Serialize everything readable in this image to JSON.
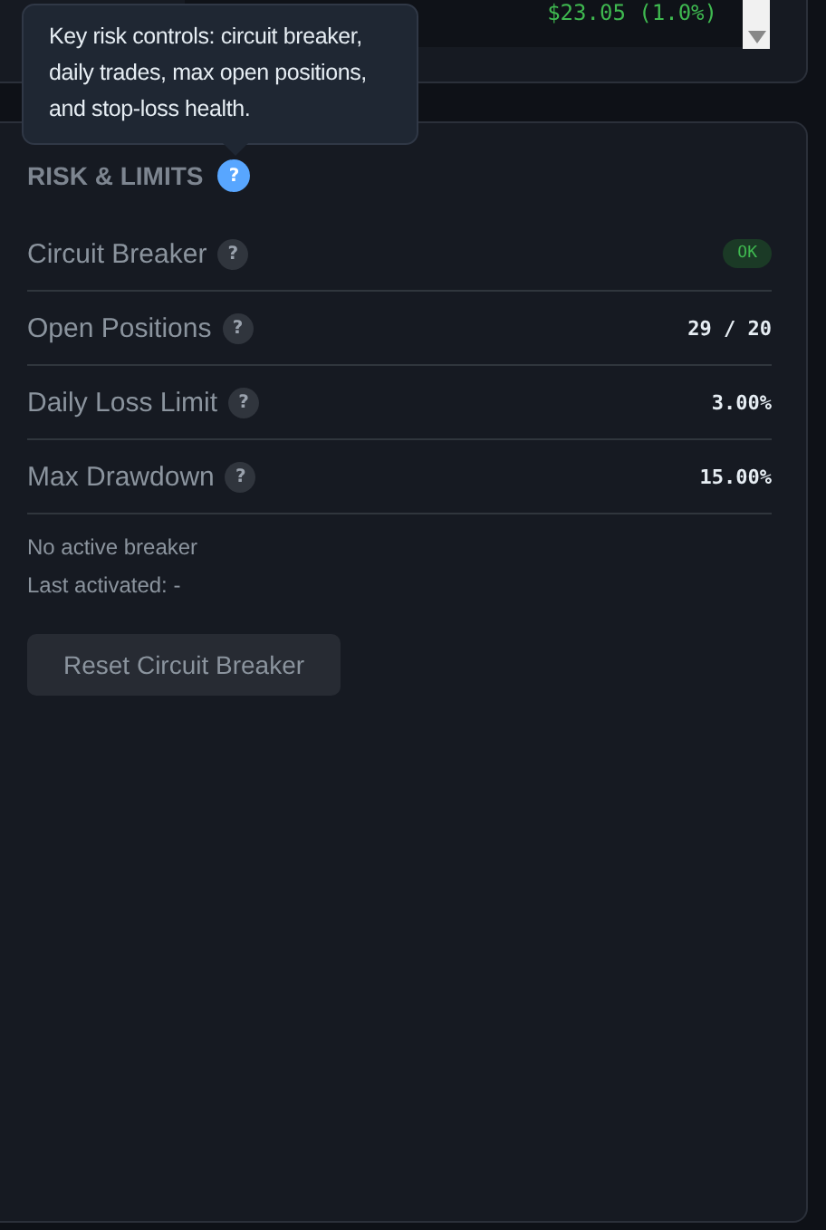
{
  "top_card": {
    "change": "$23.05 (1.0%)"
  },
  "tooltip": {
    "text": "Key risk controls: circuit breaker, daily trades, max open positions, and stop-loss health."
  },
  "panel": {
    "title": "RISK & LIMITS",
    "help": "?"
  },
  "rows": [
    {
      "label": "Circuit Breaker",
      "help": "?",
      "kind": "badge",
      "value": "OK"
    },
    {
      "label": "Open Positions",
      "help": "?",
      "kind": "text",
      "value": "29 / 20"
    },
    {
      "label": "Daily Loss Limit",
      "help": "?",
      "kind": "text",
      "value": "3.00%"
    },
    {
      "label": "Max Drawdown",
      "help": "?",
      "kind": "text",
      "value": "15.00%"
    }
  ],
  "notes": [
    "No active breaker",
    "Last activated: -"
  ],
  "button": "Reset Circuit Breaker"
}
